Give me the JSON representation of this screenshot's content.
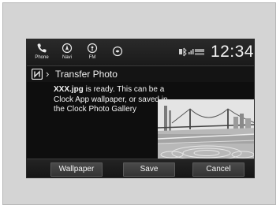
{
  "statusbar": {
    "nav": [
      {
        "label": "Phone",
        "icon": "phone-icon"
      },
      {
        "label": "Navi",
        "icon": "navi-icon"
      },
      {
        "label": "FM",
        "icon": "radio-icon"
      },
      {
        "label": "",
        "icon": "siri-icon"
      }
    ],
    "clock": "12:34"
  },
  "titlebar": {
    "icon": "nfc-icon",
    "title": "Transfer Photo"
  },
  "dialog": {
    "filename": "XXX.jpg",
    "message_rest": " is ready. This can be a Clock App wallpaper, or saved in the Clock Photo Gallery"
  },
  "buttons": {
    "wallpaper": "Wallpaper",
    "save": "Save",
    "cancel": "Cancel"
  },
  "colors": {
    "screen_bg": "#121212",
    "text": "#f0f0f0",
    "button_bg": "#3e3e3e"
  }
}
